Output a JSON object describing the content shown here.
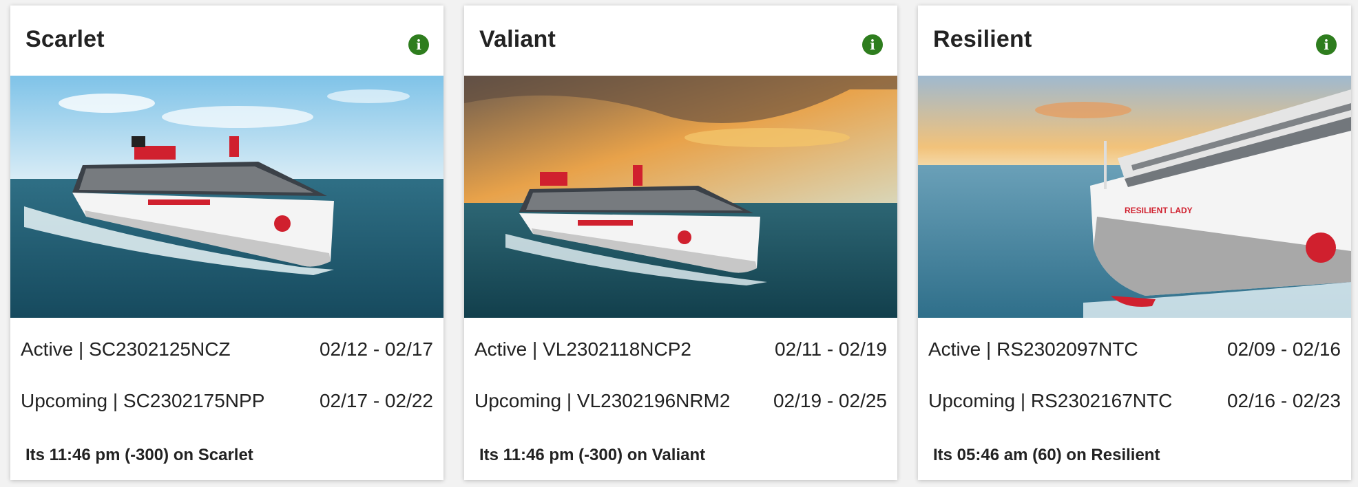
{
  "cards": [
    {
      "name": "Scarlet",
      "info_icon": "info-icon",
      "image": "ship-photo",
      "voyages": [
        {
          "status": "Active",
          "code": "SC2302125NCZ",
          "dates": "02/12 - 02/17"
        },
        {
          "status": "Upcoming",
          "code": "SC2302175NPP",
          "dates": "02/17 - 02/22"
        }
      ],
      "time_note": "Its 11:46 pm (-300) on Scarlet"
    },
    {
      "name": "Valiant",
      "info_icon": "info-icon",
      "image": "ship-photo",
      "voyages": [
        {
          "status": "Active",
          "code": "VL2302118NCP2",
          "dates": "02/11 - 02/19"
        },
        {
          "status": "Upcoming",
          "code": "VL2302196NRM2",
          "dates": "02/19 - 02/25"
        }
      ],
      "time_note": "Its 11:46 pm (-300) on Valiant"
    },
    {
      "name": "Resilient",
      "info_icon": "info-icon",
      "image": "ship-photo",
      "hull_text": "RESILIENT LADY",
      "voyages": [
        {
          "status": "Active",
          "code": "RS2302097NTC",
          "dates": "02/09 - 02/16"
        },
        {
          "status": "Upcoming",
          "code": "RS2302167NTC",
          "dates": "02/16 - 02/23"
        }
      ],
      "time_note": "Its 05:46 am (60) on Resilient"
    }
  ],
  "colors": {
    "info_icon": "#2e7d1e",
    "ship_accent": "#d0202e"
  }
}
